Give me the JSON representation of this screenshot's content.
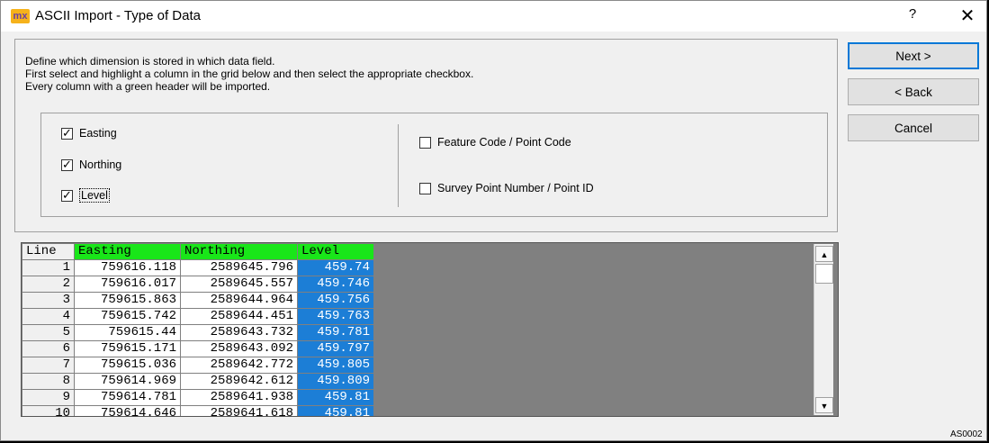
{
  "titlebar": {
    "app_icon_text": "mx",
    "app_icon": "mx-logo-icon",
    "title": "ASCII Import - Type of Data",
    "help": "?",
    "close": "✕"
  },
  "instructions": [
    "Define which dimension is stored in which data field.",
    "First select and highlight a column in the grid below and then select the appropriate checkbox.",
    "Every column with a green header will be imported."
  ],
  "checkboxes": {
    "easting": {
      "label": "Easting",
      "checked": true
    },
    "northing": {
      "label": "Northing",
      "checked": true
    },
    "level": {
      "label": "Level",
      "checked": true
    },
    "feature_code": {
      "label": "Feature Code / Point Code",
      "checked": false
    },
    "survey_point": {
      "label": "Survey Point Number / Point ID",
      "checked": false
    }
  },
  "grid": {
    "headers": [
      "Line",
      "Easting",
      "Northing",
      "Level"
    ],
    "rows": [
      [
        "1",
        "759616.118",
        "2589645.796",
        "459.74"
      ],
      [
        "2",
        "759616.017",
        "2589645.557",
        "459.746"
      ],
      [
        "3",
        "759615.863",
        "2589644.964",
        "459.756"
      ],
      [
        "4",
        "759615.742",
        "2589644.451",
        "459.763"
      ],
      [
        "5",
        "759615.44",
        "2589643.732",
        "459.781"
      ],
      [
        "6",
        "759615.171",
        "2589643.092",
        "459.797"
      ],
      [
        "7",
        "759615.036",
        "2589642.772",
        "459.805"
      ],
      [
        "8",
        "759614.969",
        "2589642.612",
        "459.809"
      ],
      [
        "9",
        "759614.781",
        "2589641.938",
        "459.81"
      ],
      [
        "10",
        "759614.646",
        "2589641.618",
        "459.81"
      ]
    ],
    "colors": {
      "imported_header": "#19e619",
      "selected_column": "#1c7ed6",
      "empty_area": "#808080"
    }
  },
  "buttons": {
    "next": "Next >",
    "back": "< Back",
    "cancel": "Cancel"
  },
  "status_code": "AS0002"
}
